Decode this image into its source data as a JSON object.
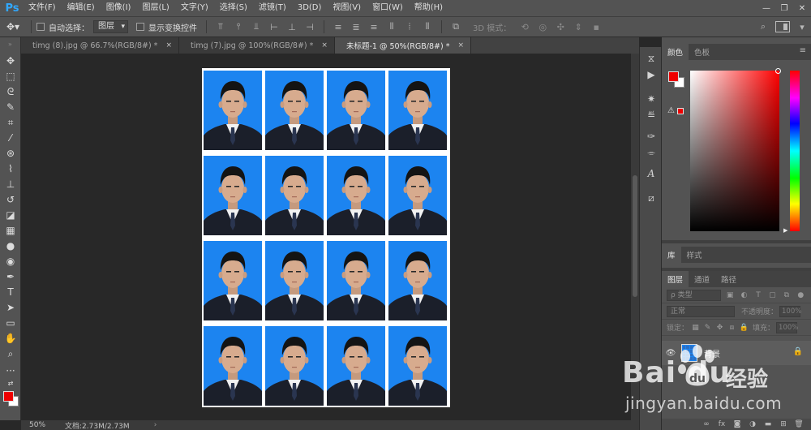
{
  "app": {
    "logo": "Ps"
  },
  "menu": [
    "文件(F)",
    "编辑(E)",
    "图像(I)",
    "图层(L)",
    "文字(Y)",
    "选择(S)",
    "滤镜(T)",
    "3D(D)",
    "视图(V)",
    "窗口(W)",
    "帮助(H)"
  ],
  "window_controls": {
    "minimize": "—",
    "restore": "❐",
    "close": "✕"
  },
  "options": {
    "auto_select_label": "自动选择：",
    "auto_select_value": "图层",
    "show_transform_label": "显示变换控件",
    "mode_label": "3D 模式："
  },
  "tabs": [
    {
      "label": "timg (8).jpg @ 66.7%(RGB/8#) *",
      "close": "×"
    },
    {
      "label": "timg (7).jpg @ 100%(RGB/8#) *",
      "close": "×"
    },
    {
      "label": "未标题-1 @ 50%(RGB/8#) *",
      "close": "×"
    }
  ],
  "canvas": {
    "rows": 4,
    "cols": 4,
    "photo_bg": "#1c84f0"
  },
  "status": {
    "zoom": "50%",
    "doc_info": "文档:2.73M/2.73M",
    "arrow": "›"
  },
  "color_panel": {
    "tabs": [
      "颜色",
      "色板"
    ],
    "foreground": "#ee0000",
    "background": "#ffffff",
    "warning_icon": "⚠"
  },
  "library_panel": {
    "tabs": [
      "库",
      "样式"
    ]
  },
  "layers_panel": {
    "tabs": [
      "图层",
      "通道",
      "路径"
    ],
    "search_placeholder": "ρ 类型",
    "blend_mode": "正常",
    "opacity_label": "不透明度：",
    "opacity_value": "100%",
    "lock_label": "锁定：",
    "fill_label": "填充：",
    "fill_value": "100%",
    "layer": {
      "name": "背景",
      "visible_icon": "👁",
      "lock_icon": "🔒"
    }
  },
  "watermark": {
    "brand": "Bai  du",
    "product": "经验",
    "url": "jingyan.baidu.com"
  }
}
